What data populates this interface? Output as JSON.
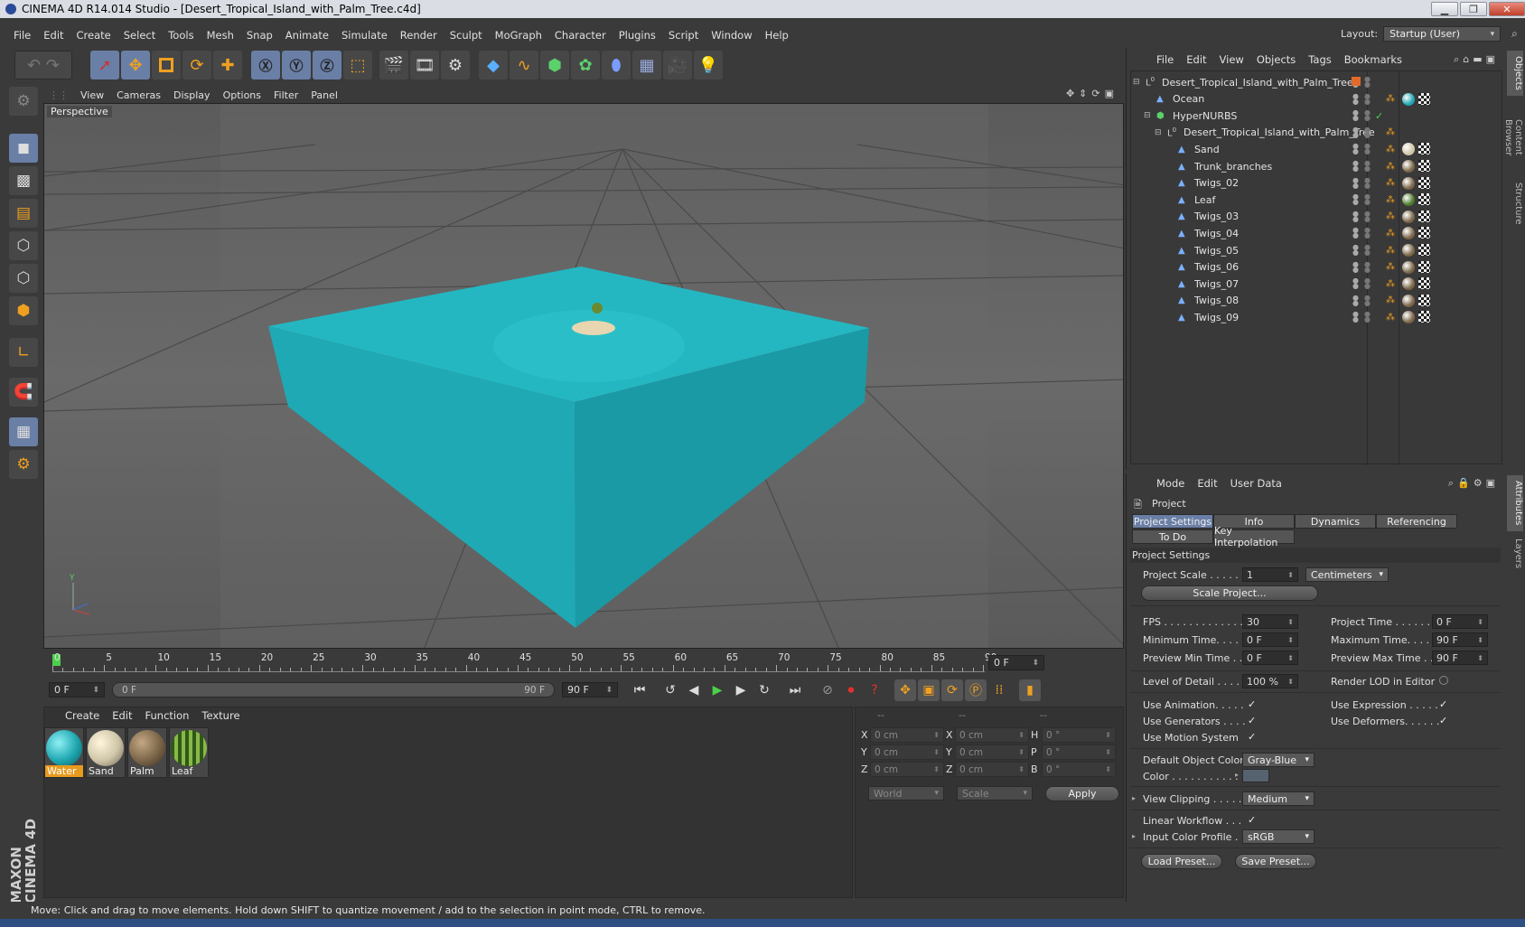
{
  "app": {
    "title": "CINEMA 4D R14.014 Studio - [Desert_Tropical_Island_with_Palm_Tree.c4d]",
    "layout_label": "Layout:",
    "layout_value": "Startup (User)"
  },
  "menu": [
    "File",
    "Edit",
    "Create",
    "Select",
    "Tools",
    "Mesh",
    "Snap",
    "Animate",
    "Simulate",
    "Render",
    "Sculpt",
    "MoGraph",
    "Character",
    "Plugins",
    "Script",
    "Window",
    "Help"
  ],
  "viewport": {
    "menu": [
      "View",
      "Cameras",
      "Display",
      "Options",
      "Filter",
      "Panel"
    ],
    "label": "Perspective"
  },
  "timeline": {
    "ticks": [
      "0",
      "5",
      "10",
      "15",
      "20",
      "25",
      "30",
      "35",
      "40",
      "45",
      "50",
      "55",
      "60",
      "65",
      "70",
      "75",
      "80",
      "85",
      "90"
    ],
    "current_frame": "0 F",
    "start": "0 F",
    "range_start": "0 F",
    "range_end": "90 F",
    "end": "90 F"
  },
  "materials": {
    "menu": [
      "Create",
      "Edit",
      "Function",
      "Texture"
    ],
    "items": [
      {
        "name": "Water",
        "color": "#1fa6b0"
      },
      {
        "name": "Sand",
        "color": "#cfc5a8"
      },
      {
        "name": "Palm",
        "color": "#7a6548"
      },
      {
        "name": "Leaf",
        "color": "#4e7a2c"
      }
    ]
  },
  "coords": {
    "headers": [
      "--",
      "--",
      "--"
    ],
    "rows": [
      {
        "a": "X",
        "av": "0 cm",
        "b": "X",
        "bv": "0 cm",
        "c": "H",
        "cv": "0 °"
      },
      {
        "a": "Y",
        "av": "0 cm",
        "b": "Y",
        "bv": "0 cm",
        "c": "P",
        "cv": "0 °"
      },
      {
        "a": "Z",
        "av": "0 cm",
        "b": "Z",
        "bv": "0 cm",
        "c": "B",
        "cv": "0 °"
      }
    ],
    "mode1": "World",
    "mode2": "Scale",
    "apply": "Apply"
  },
  "status": "Move: Click and drag to move elements. Hold down SHIFT to quantize movement / add to the selection in point mode, CTRL to remove.",
  "maxon": "MAXON CINEMA 4D",
  "objects": {
    "menu": [
      "File",
      "Edit",
      "View",
      "Objects",
      "Tags",
      "Bookmarks"
    ],
    "rows": [
      {
        "name": "Desert_Tropical_Island_with_Palm_Tree",
        "indent": 0,
        "type": "null"
      },
      {
        "name": "Ocean",
        "indent": 1,
        "type": "poly"
      },
      {
        "name": "HyperNURBS",
        "indent": 1,
        "type": "nurbs"
      },
      {
        "name": "Desert_Tropical_Island_with_Palm_Tree",
        "indent": 2,
        "type": "null"
      },
      {
        "name": "Sand",
        "indent": 3,
        "type": "poly"
      },
      {
        "name": "Trunk_branches",
        "indent": 3,
        "type": "poly"
      },
      {
        "name": "Twigs_02",
        "indent": 3,
        "type": "poly"
      },
      {
        "name": "Leaf",
        "indent": 3,
        "type": "poly"
      },
      {
        "name": "Twigs_03",
        "indent": 3,
        "type": "poly"
      },
      {
        "name": "Twigs_04",
        "indent": 3,
        "type": "poly"
      },
      {
        "name": "Twigs_05",
        "indent": 3,
        "type": "poly"
      },
      {
        "name": "Twigs_06",
        "indent": 3,
        "type": "poly"
      },
      {
        "name": "Twigs_07",
        "indent": 3,
        "type": "poly"
      },
      {
        "name": "Twigs_08",
        "indent": 3,
        "type": "poly"
      },
      {
        "name": "Twigs_09",
        "indent": 3,
        "type": "poly"
      }
    ]
  },
  "side_tabs": [
    "Objects",
    "Content Browser",
    "Structure",
    "Attributes",
    "Layers"
  ],
  "attributes": {
    "menu": [
      "Mode",
      "Edit",
      "User Data"
    ],
    "object": "Project",
    "tabs_row1": [
      "Project Settings",
      "Info",
      "Dynamics",
      "Referencing"
    ],
    "tabs_row2": [
      "To Do",
      "Key Interpolation"
    ],
    "section": "Project Settings",
    "project_scale_label": "Project Scale . . . . . .",
    "project_scale_value": "1",
    "project_scale_unit": "Centimeters",
    "scale_project_btn": "Scale Project...",
    "fps_label": "FPS . . . . . . . . . . . . . .",
    "fps_value": "30",
    "project_time_label": "Project Time . . . . . . .",
    "project_time_value": "0 F",
    "min_time_label": "Minimum Time. . . . . .",
    "min_time_value": "0 F",
    "max_time_label": "Maximum Time. . . . . .",
    "max_time_value": "90 F",
    "prev_min_label": "Preview Min Time . . .",
    "prev_min_value": "0 F",
    "prev_max_label": "Preview Max Time . . .",
    "prev_max_value": "90 F",
    "lod_label": "Level of Detail . . . . .",
    "lod_value": "100 %",
    "render_lod_label": "Render LOD in Editor",
    "use_anim_label": "Use Animation. . . . .",
    "use_expr_label": "Use Expression . . . . .",
    "use_gen_label": "Use Generators . . . .",
    "use_def_label": "Use Deformers. . . . . .",
    "use_motion_label": "Use Motion System",
    "def_color_label": "Default Object Color",
    "def_color_value": "Gray-Blue",
    "color_label": "Color . . . . . . . . . . .",
    "view_clip_label": "View Clipping . . . . .",
    "view_clip_value": "Medium",
    "linear_label": "Linear Workflow . . .",
    "input_profile_label": "Input Color Profile .",
    "input_profile_value": "sRGB",
    "load_preset": "Load Preset...",
    "save_preset": "Save Preset...",
    "check": "✓"
  }
}
